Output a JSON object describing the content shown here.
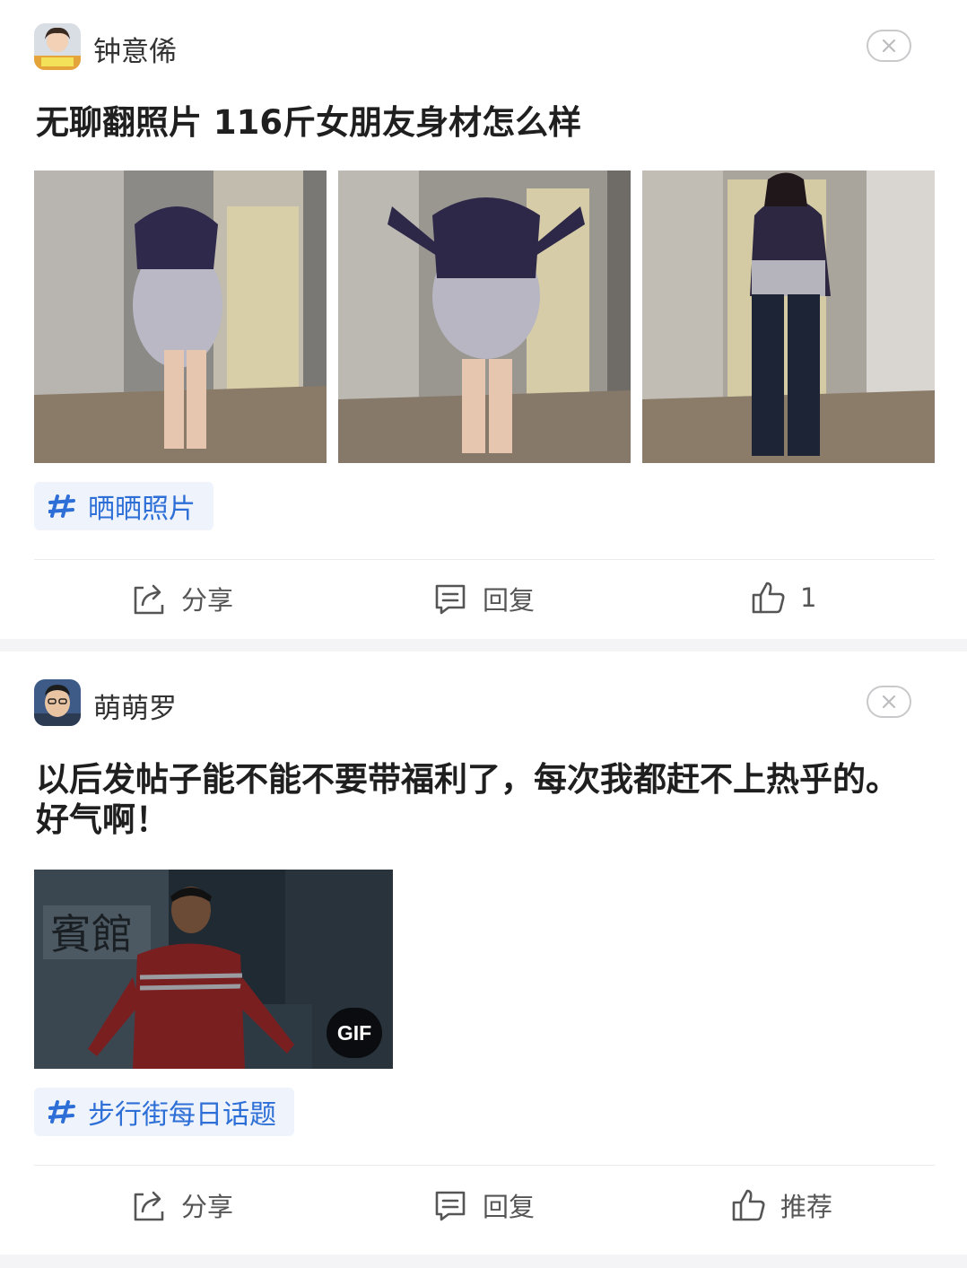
{
  "posts": [
    {
      "author": "钟意俙",
      "avatar_icon": "user-avatar-girl",
      "title": "无聊翻照片  116斤女朋友身材怎么样",
      "topic": "晒晒照片",
      "actions": {
        "share": "分享",
        "reply": "回复",
        "like": "1"
      }
    },
    {
      "author": "萌萌罗",
      "avatar_icon": "user-avatar-man",
      "title": "以后发帖子能不能不要带福利了，每次我都赶不上热乎的。好气啊！",
      "gif_badge": "GIF",
      "topic": "步行街每日话题",
      "actions": {
        "share": "分享",
        "reply": "回复",
        "like": "推荐"
      }
    }
  ],
  "colors": {
    "topic_text": "#2d6fd6",
    "topic_bg": "#eef3fc",
    "icon": "#555555",
    "separator": "#f4f4f6"
  }
}
